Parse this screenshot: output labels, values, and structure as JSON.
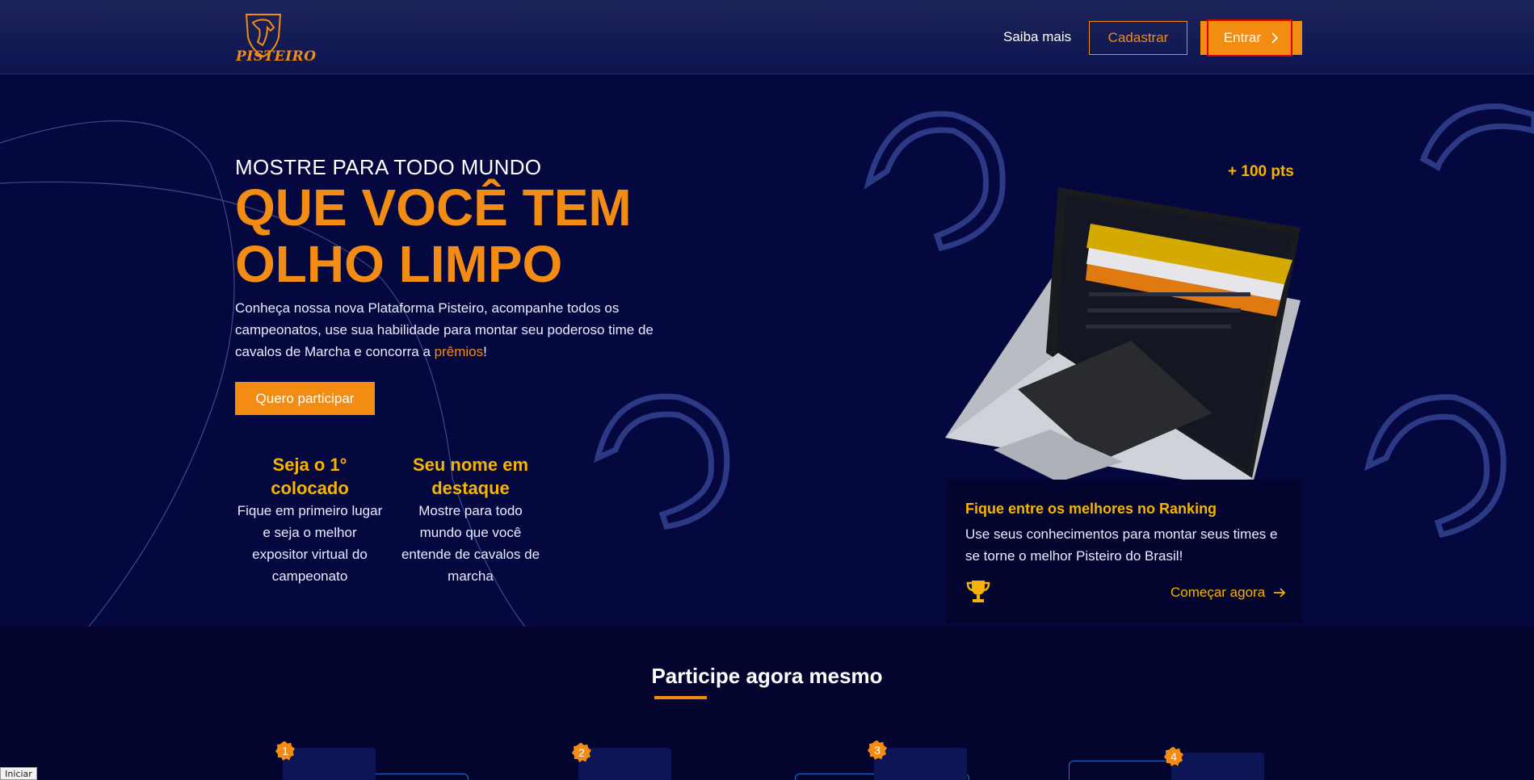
{
  "header": {
    "logo_text": "PISTEIRO",
    "nav_link": "Saiba mais",
    "register_label": "Cadastrar",
    "login_label": "Entrar"
  },
  "hero": {
    "kicker": "MOSTRE PARA TODO MUNDO",
    "title": "QUE VOCÊ TEM OLHO LIMPO",
    "desc_before": "Conheça nossa nova Plataforma Pisteiro, acompanhe todos os campeonatos, use sua habilidade para montar seu poderoso time de cavalos de Marcha e concorra a ",
    "desc_highlight": "prêmios",
    "desc_after": "!",
    "cta_label": "Quero participar",
    "features": [
      {
        "title": "Seja o 1° colocado",
        "text": "Fique em primeiro lugar e seja o melhor expositor virtual do campeonato"
      },
      {
        "title": "Seu nome em destaque",
        "text": "Mostre para todo mundo que você entende de cavalos de marcha"
      }
    ],
    "points_badge": "+ 100 pts"
  },
  "ranking_card": {
    "title": "Fique entre os melhores no Ranking",
    "text": "Use seus conhecimentos para montar seus times e se torne o melhor Pisteiro do Brasil!",
    "cta_label": "Começar agora"
  },
  "participate": {
    "title": "Participe agora mesmo",
    "steps": [
      "1",
      "2",
      "3",
      "4"
    ]
  },
  "status_bar": {
    "label": "Iniciar"
  },
  "colors": {
    "background": "#05083f",
    "accent_orange": "#f28c12",
    "accent_yellow": "#f5b400"
  },
  "icons": [
    "horse-shield-logo-icon",
    "chevron-right-icon",
    "trophy-icon",
    "arrow-right-icon",
    "horseshoe-icon"
  ]
}
